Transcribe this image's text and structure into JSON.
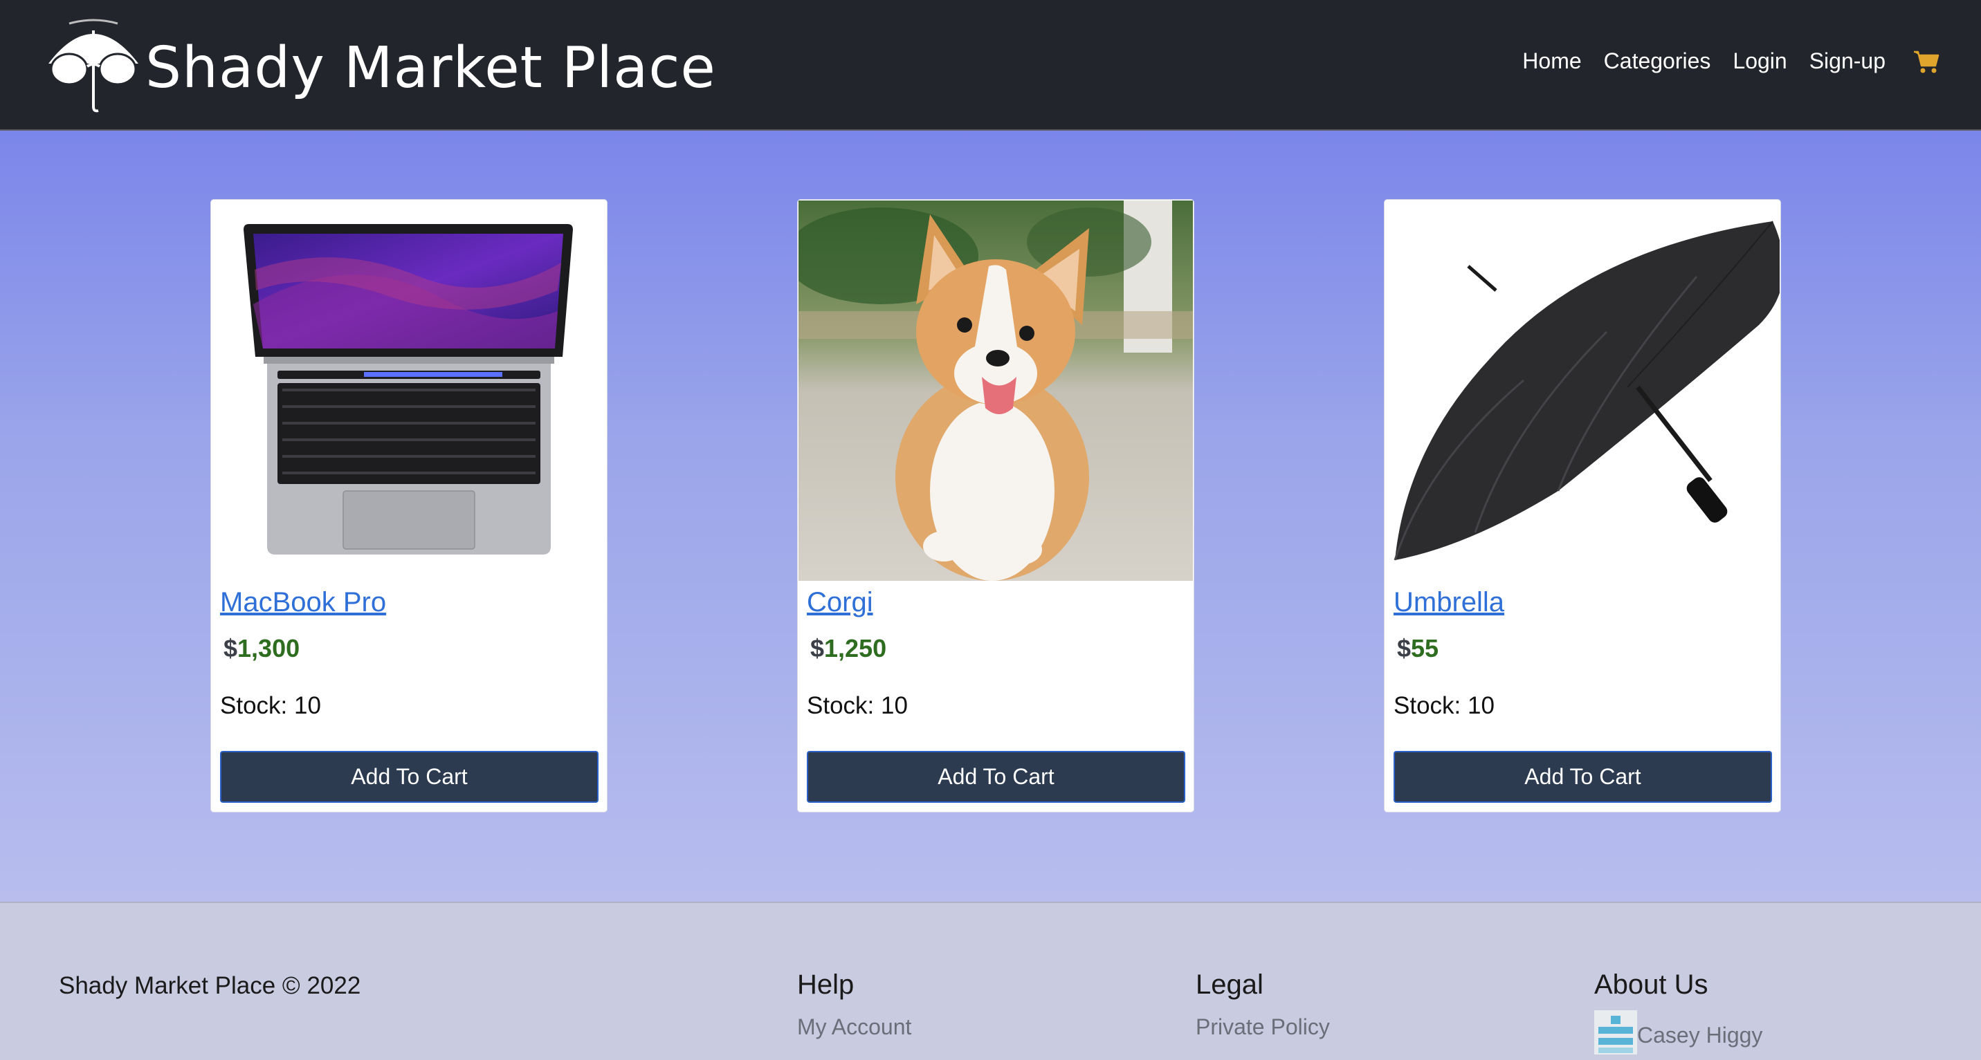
{
  "header": {
    "brand_name": "Shady Market Place",
    "nav": [
      "Home",
      "Categories",
      "Login",
      "Sign-up"
    ],
    "cart_icon": "shopping-cart-icon",
    "cart_icon_color": "#e0a52c"
  },
  "products": [
    {
      "name": "MacBook Pro",
      "currency": "$",
      "price": "1,300",
      "stock": "Stock: 10",
      "button": "Add To Cart",
      "image": "laptop-image"
    },
    {
      "name": "Corgi",
      "currency": "$",
      "price": "1,250",
      "stock": "Stock: 10",
      "button": "Add To Cart",
      "image": "corgi-image"
    },
    {
      "name": "Umbrella",
      "currency": "$",
      "price": "55",
      "stock": "Stock: 10",
      "button": "Add To Cart",
      "image": "umbrella-image"
    }
  ],
  "footer": {
    "copyright": "Shady Market Place © 2022",
    "help": {
      "heading": "Help",
      "links": [
        "My Account"
      ]
    },
    "legal": {
      "heading": "Legal",
      "links": [
        "Private Policy"
      ]
    },
    "about": {
      "heading": "About Us",
      "members": [
        "Casey Higgy"
      ]
    }
  },
  "colors": {
    "navbar": "#22252b",
    "link": "#2e6fd8",
    "price": "#2e6c1f",
    "button": "#2c3b4f",
    "footer": "#c9cbe1"
  }
}
